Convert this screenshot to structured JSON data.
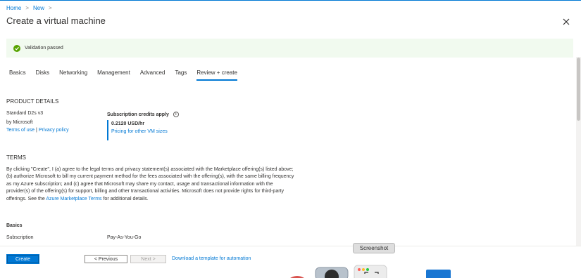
{
  "breadcrumb": {
    "home": "Home",
    "new": "New"
  },
  "page_title": "Create a virtual machine",
  "validation": {
    "text": "Validation passed"
  },
  "tabs": [
    {
      "label": "Basics"
    },
    {
      "label": "Disks"
    },
    {
      "label": "Networking"
    },
    {
      "label": "Management"
    },
    {
      "label": "Advanced"
    },
    {
      "label": "Tags"
    },
    {
      "label": "Review + create",
      "active": true
    }
  ],
  "product": {
    "heading": "PRODUCT DETAILS",
    "name": "Standard D2s v3",
    "publisher": "by Microsoft",
    "terms_link": "Terms of use",
    "separator": "|",
    "privacy_link": "Privacy policy",
    "credits_label": "Subscription credits apply",
    "price": "0.2120 USD/hr",
    "pricing_link": "Pricing for other VM sizes"
  },
  "terms": {
    "heading": "TERMS",
    "body_part1": "By clicking \"Create\", I (a) agree to the legal terms and privacy statement(s) associated with the Marketplace offering(s) listed above; (b) authorize Microsoft to bill my current payment method for the fees associated with the offering(s), with the same billing frequency as my Azure subscription; and (c) agree that Microsoft may share my contact, usage and transactional information with the provider(s) of the offering(s) for support, billing and other transactional activities. Microsoft does not provide rights for third-party offerings. See the ",
    "body_link": "Azure Marketplace Terms",
    "body_part2": " for additional details."
  },
  "basics": {
    "heading": "Basics",
    "subscription_label": "Subscription",
    "subscription_value": "Pay-As-You-Go"
  },
  "footer": {
    "create": "Create",
    "previous": "< Previous",
    "next": "Next >",
    "download": "Download a template for automation"
  },
  "tooltip": "Screenshot",
  "colors": {
    "accent": "#0078d4",
    "success": "#57a300",
    "success_bg": "#f1faef"
  }
}
